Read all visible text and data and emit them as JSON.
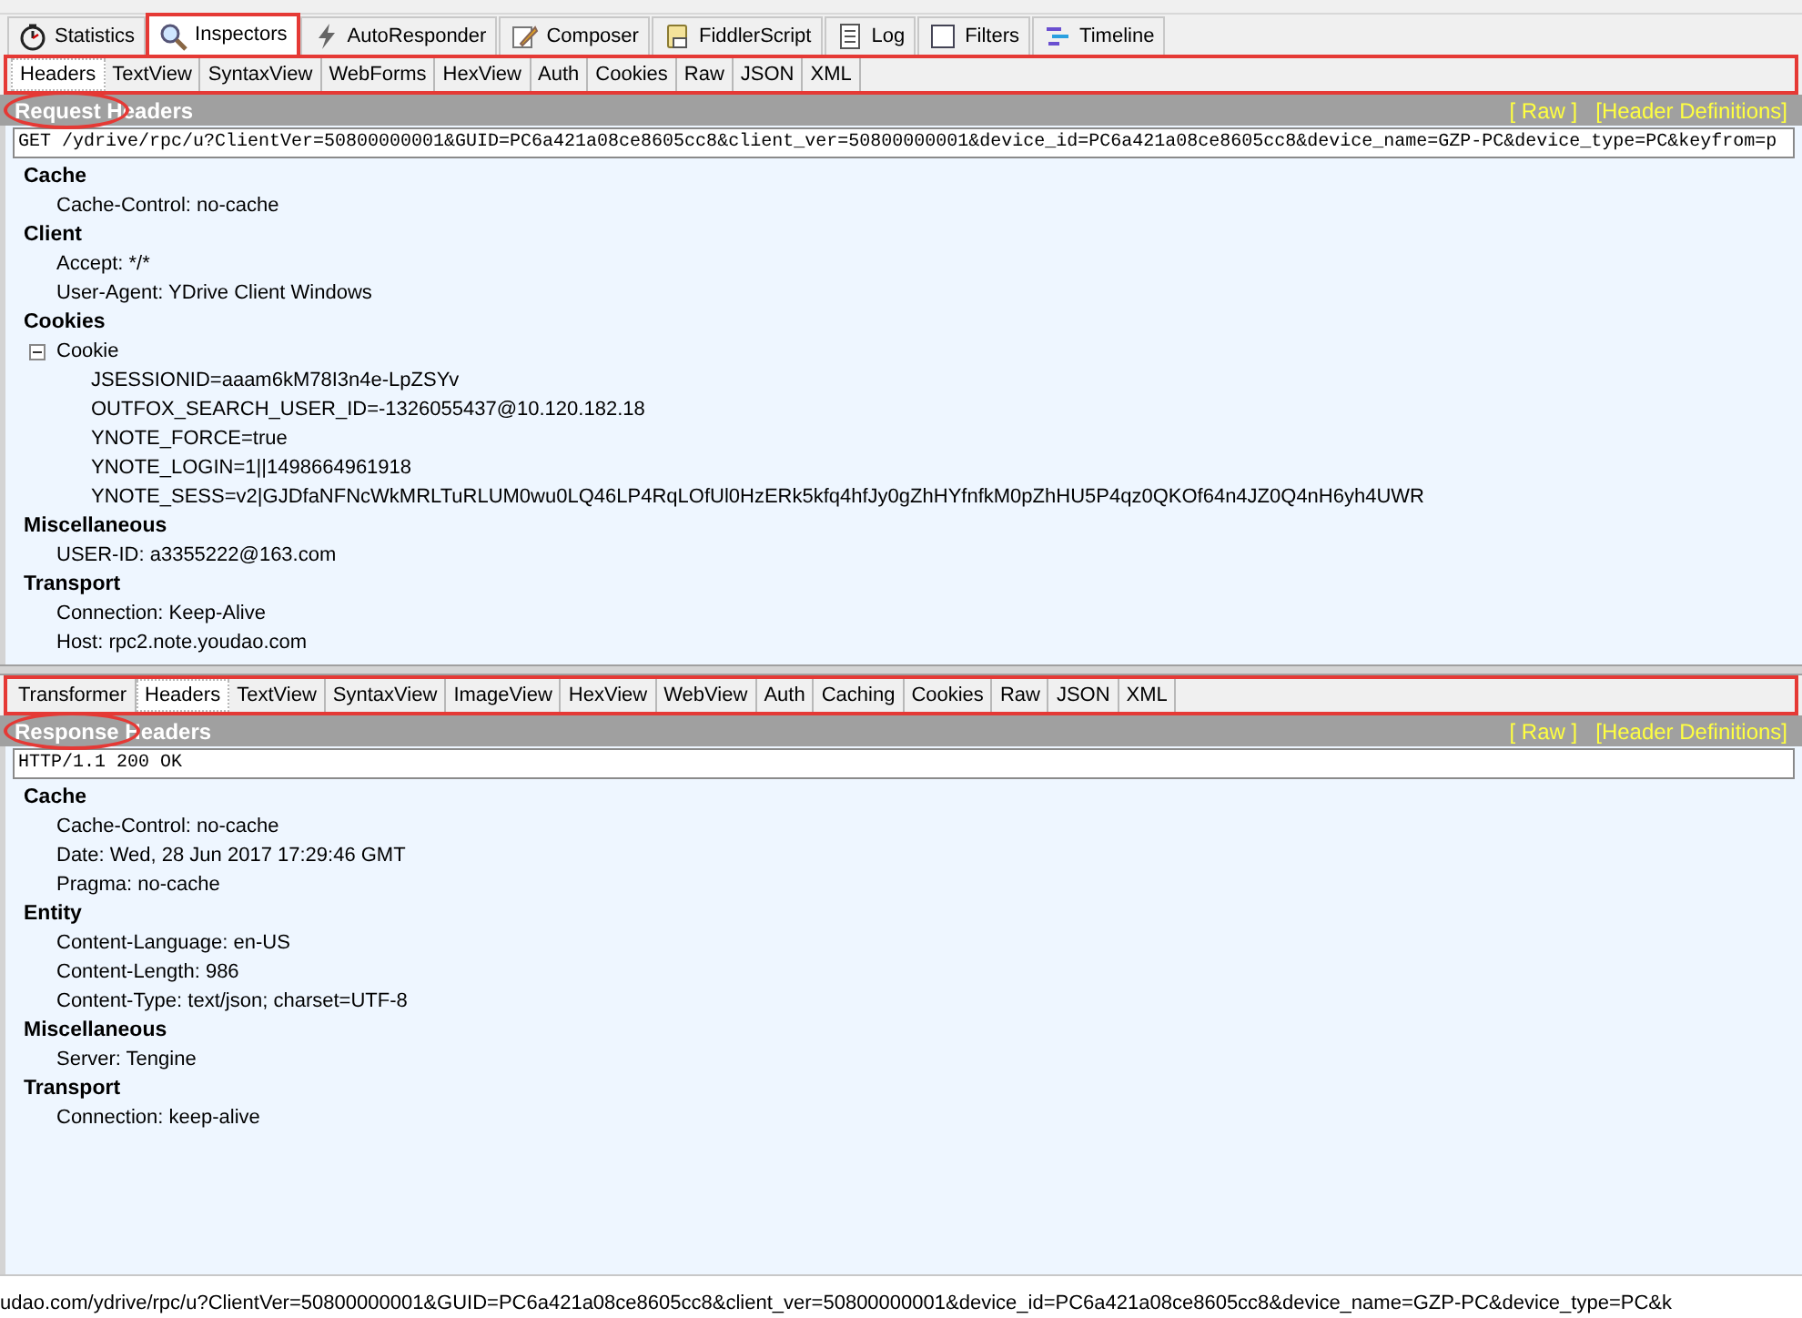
{
  "main_tabs": [
    {
      "label": "Statistics",
      "kind": "stopwatch",
      "selected": false,
      "annotated": false
    },
    {
      "label": "Inspectors",
      "kind": "magnifier",
      "selected": true,
      "annotated": true
    },
    {
      "label": "AutoResponder",
      "kind": "lightning",
      "selected": false,
      "annotated": false
    },
    {
      "label": "Composer",
      "kind": "pencil",
      "selected": false,
      "annotated": false
    },
    {
      "label": "FiddlerScript",
      "kind": "script",
      "selected": false,
      "annotated": false
    },
    {
      "label": "Log",
      "kind": "document",
      "selected": false,
      "annotated": false
    },
    {
      "label": "Filters",
      "kind": "checkbox",
      "selected": false,
      "annotated": false
    },
    {
      "label": "Timeline",
      "kind": "timeline",
      "selected": false,
      "annotated": false
    }
  ],
  "request": {
    "tabs_annotated": true,
    "title_circled": true,
    "tabs": [
      {
        "label": "Headers",
        "selected": true
      },
      {
        "label": "TextView",
        "selected": false
      },
      {
        "label": "SyntaxView",
        "selected": false
      },
      {
        "label": "WebForms",
        "selected": false
      },
      {
        "label": "HexView",
        "selected": false
      },
      {
        "label": "Auth",
        "selected": false
      },
      {
        "label": "Cookies",
        "selected": false
      },
      {
        "label": "Raw",
        "selected": false
      },
      {
        "label": "JSON",
        "selected": false
      },
      {
        "label": "XML",
        "selected": false
      }
    ],
    "title": "Request Headers",
    "links": [
      "[ Raw ]",
      "[Header Definitions]"
    ],
    "first_line": "GET /ydrive/rpc/u?ClientVer=50800000001&GUID=PC6a421a08ce8605cc8&client_ver=50800000001&device_id=PC6a421a08ce8605cc8&device_name=GZP-PC&device_type=PC&keyfrom=p",
    "groups": [
      {
        "name": "Cache",
        "items": [
          {
            "text": "Cache-Control: no-cache"
          }
        ]
      },
      {
        "name": "Client",
        "items": [
          {
            "text": "Accept: */*"
          },
          {
            "text": "User-Agent: YDrive Client Windows"
          }
        ]
      },
      {
        "name": "Cookies",
        "items": [
          {
            "text": "Cookie",
            "expanded": true,
            "children": [
              {
                "text": "JSESSIONID=aaam6kM78I3n4e-LpZSYv"
              },
              {
                "text": "OUTFOX_SEARCH_USER_ID=-1326055437@10.120.182.18"
              },
              {
                "text": "YNOTE_FORCE=true"
              },
              {
                "text": "YNOTE_LOGIN=1||1498664961918"
              },
              {
                "text": "YNOTE_SESS=v2|GJDfaNFNcWkMRLTuRLUM0wu0LQ46LP4RqLOfUl0HzERk5kfq4hfJy0gZhHYfnfkM0pZhHU5P4qz0QKOf64n4JZ0Q4nH6yh4UWR"
              }
            ]
          }
        ]
      },
      {
        "name": "Miscellaneous",
        "items": [
          {
            "text": "USER-ID: a3355222@163.com"
          }
        ]
      },
      {
        "name": "Transport",
        "items": [
          {
            "text": "Connection: Keep-Alive"
          },
          {
            "text": "Host: rpc2.note.youdao.com"
          }
        ]
      }
    ]
  },
  "response": {
    "tabs_annotated": true,
    "title_circled": true,
    "tabs": [
      {
        "label": "Transformer",
        "selected": false
      },
      {
        "label": "Headers",
        "selected": true
      },
      {
        "label": "TextView",
        "selected": false
      },
      {
        "label": "SyntaxView",
        "selected": false
      },
      {
        "label": "ImageView",
        "selected": false
      },
      {
        "label": "HexView",
        "selected": false
      },
      {
        "label": "WebView",
        "selected": false
      },
      {
        "label": "Auth",
        "selected": false
      },
      {
        "label": "Caching",
        "selected": false
      },
      {
        "label": "Cookies",
        "selected": false
      },
      {
        "label": "Raw",
        "selected": false
      },
      {
        "label": "JSON",
        "selected": false
      },
      {
        "label": "XML",
        "selected": false
      }
    ],
    "title": "Response Headers",
    "links": [
      "[ Raw ]",
      "[Header Definitions]"
    ],
    "first_line": "HTTP/1.1 200 OK",
    "groups": [
      {
        "name": "Cache",
        "items": [
          {
            "text": "Cache-Control: no-cache"
          },
          {
            "text": "Date: Wed, 28 Jun 2017 17:29:46 GMT"
          },
          {
            "text": "Pragma: no-cache"
          }
        ]
      },
      {
        "name": "Entity",
        "items": [
          {
            "text": "Content-Language: en-US"
          },
          {
            "text": "Content-Length: 986"
          },
          {
            "text": "Content-Type: text/json; charset=UTF-8"
          }
        ]
      },
      {
        "name": "Miscellaneous",
        "items": [
          {
            "text": "Server: Tengine"
          }
        ]
      },
      {
        "name": "Transport",
        "items": [
          {
            "text": "Connection: keep-alive"
          }
        ]
      }
    ]
  },
  "status_bar": {
    "text": "udao.com/ydrive/rpc/u?ClientVer=50800000001&GUID=PC6a421a08ce8605cc8&client_ver=50800000001&device_id=PC6a421a08ce8605cc8&device_name=GZP-PC&device_type=PC&k"
  }
}
